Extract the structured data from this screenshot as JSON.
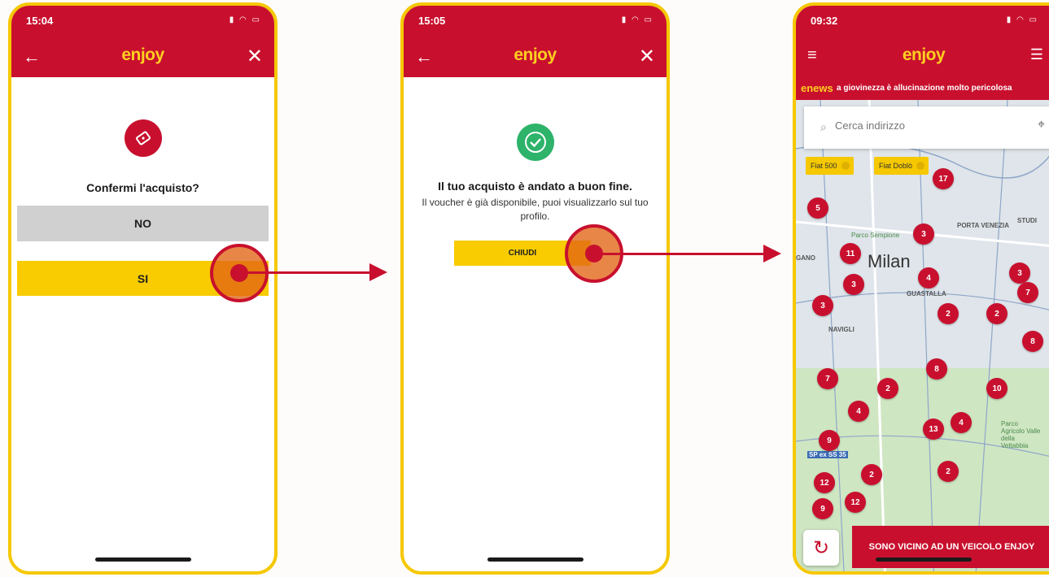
{
  "colors": {
    "brand_red": "#c8102e",
    "brand_yellow": "#f5c800",
    "tap_orange": "#e06414"
  },
  "screen1": {
    "status_time": "15:04",
    "logo": "enjoy",
    "title": "Confermi l'acquisto?",
    "no_label": "NO",
    "si_label": "SI"
  },
  "screen2": {
    "status_time": "15:05",
    "logo": "enjoy",
    "title": "Il tuo acquisto è andato a buon fine.",
    "message": "Il voucher è già disponibile, puoi visualizzarlo sul tuo profilo.",
    "button_label": "CHIUDI"
  },
  "screen3": {
    "status_time": "09:32",
    "logo": "enjoy",
    "news_logo": "enews",
    "news_ticker": "a giovinezza è allucinazione molto pericolosa",
    "search_placeholder": "Cerca indirizzo",
    "filters": [
      "Fiat 500",
      "Fiat Doblò"
    ],
    "map_labels": [
      "Parco Sempione",
      "PORTA VENEZIA",
      "GUASTALLA",
      "NAVIGLI",
      "STUDI",
      "Parco Agricolo Valle della Vettabbia",
      "SP ex SS 35",
      "GANO"
    ],
    "city_label": "Milan",
    "cluster_counts": [
      "5",
      "17",
      "3",
      "11",
      "3",
      "4",
      "3",
      "2",
      "2",
      "3",
      "7",
      "8",
      "8",
      "7",
      "2",
      "4",
      "10",
      "9",
      "13",
      "4",
      "2",
      "12",
      "2",
      "12",
      "9"
    ],
    "cta_label": "SONO VICINO AD UN VEICOLO ENJOY"
  }
}
